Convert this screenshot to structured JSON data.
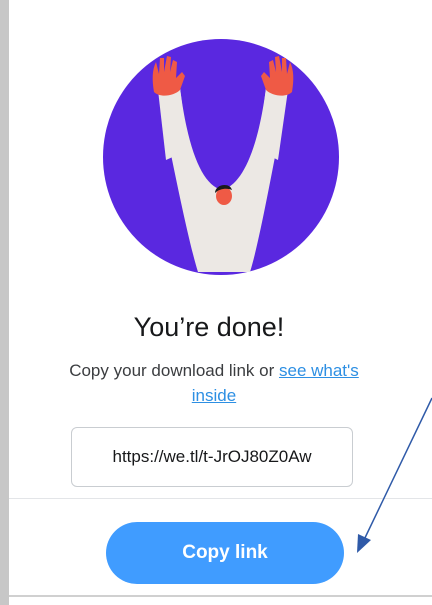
{
  "dialog": {
    "title": "You’re done!",
    "subtitle_text": "Copy your download link or ",
    "subtitle_link": "see what's inside",
    "download_link": "https://we.tl/t-JrOJ80Z0Aw",
    "copy_button_label": "Copy link"
  },
  "colors": {
    "accent": "#409cff",
    "link": "#2d8fe3",
    "illustration_circle": "#5a28e0",
    "hands": "#ef5a45"
  },
  "icons": {
    "illustration": "celebrating-person-illustration",
    "annotation": "arrow-annotation"
  }
}
